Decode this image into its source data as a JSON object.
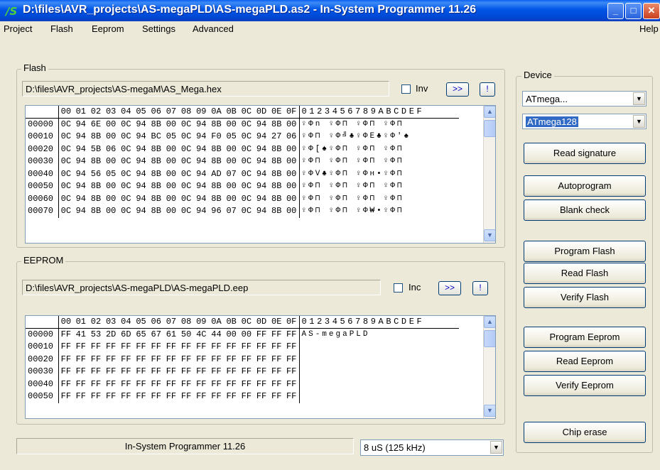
{
  "window": {
    "title": "D:\\files\\AVR_projects\\AS-megaPLD\\AS-megaPLD.as2 - In-System Programmer 11.26",
    "icon": "app-logo-icon"
  },
  "menu": {
    "project": "Project",
    "flash": "Flash",
    "eeprom": "Eeprom",
    "settings": "Settings",
    "advanced": "Advanced",
    "help": "Help"
  },
  "flash": {
    "group_label": "Flash",
    "path": "D:\\files\\AVR_projects\\AS-megaM\\AS_Mega.hex",
    "inv_label": "Inv",
    "inv_checked": false,
    "more_label": ">>",
    "alert_label": "!"
  },
  "eeprom": {
    "group_label": "EEPROM",
    "path": "D:\\files\\AVR_projects\\AS-megaPLD\\AS-megaPLD.eep",
    "inc_label": "Inc",
    "inc_checked": false,
    "more_label": ">>",
    "alert_label": "!"
  },
  "hex_header": {
    "columns": [
      "00",
      "01",
      "02",
      "03",
      "04",
      "05",
      "06",
      "07",
      "08",
      "09",
      "0A",
      "0B",
      "0C",
      "0D",
      "0E",
      "0F"
    ],
    "ascii": "0123456789ABCDEF"
  },
  "flash_rows": [
    {
      "addr": "00000",
      "bytes": [
        "0C",
        "94",
        "6E",
        "00",
        "0C",
        "94",
        "8B",
        "00",
        "0C",
        "94",
        "8B",
        "00",
        "0C",
        "94",
        "8B",
        "00"
      ],
      "ascii": "♀Φn ♀Φ⊓ ♀Φ⊓ ♀Φ⊓"
    },
    {
      "addr": "00010",
      "bytes": [
        "0C",
        "94",
        "8B",
        "00",
        "0C",
        "94",
        "BC",
        "05",
        "0C",
        "94",
        "F0",
        "05",
        "0C",
        "94",
        "27",
        "06"
      ],
      "ascii": "♀Φ⊓ ♀Φ╝♣♀ΦΕ♣♀Φ'♠"
    },
    {
      "addr": "00020",
      "bytes": [
        "0C",
        "94",
        "5B",
        "06",
        "0C",
        "94",
        "8B",
        "00",
        "0C",
        "94",
        "8B",
        "00",
        "0C",
        "94",
        "8B",
        "00"
      ],
      "ascii": "♀Φ[♠♀Φ⊓ ♀Φ⊓ ♀Φ⊓"
    },
    {
      "addr": "00030",
      "bytes": [
        "0C",
        "94",
        "8B",
        "00",
        "0C",
        "94",
        "8B",
        "00",
        "0C",
        "94",
        "8B",
        "00",
        "0C",
        "94",
        "8B",
        "00"
      ],
      "ascii": "♀Φ⊓ ♀Φ⊓ ♀Φ⊓ ♀Φ⊓"
    },
    {
      "addr": "00040",
      "bytes": [
        "0C",
        "94",
        "56",
        "05",
        "0C",
        "94",
        "8B",
        "00",
        "0C",
        "94",
        "AD",
        "07",
        "0C",
        "94",
        "8B",
        "00"
      ],
      "ascii": "♀ΦV♣♀Φ⊓ ♀Φн•♀Φ⊓"
    },
    {
      "addr": "00050",
      "bytes": [
        "0C",
        "94",
        "8B",
        "00",
        "0C",
        "94",
        "8B",
        "00",
        "0C",
        "94",
        "8B",
        "00",
        "0C",
        "94",
        "8B",
        "00"
      ],
      "ascii": "♀Φ⊓ ♀Φ⊓ ♀Φ⊓ ♀Φ⊓"
    },
    {
      "addr": "00060",
      "bytes": [
        "0C",
        "94",
        "8B",
        "00",
        "0C",
        "94",
        "8B",
        "00",
        "0C",
        "94",
        "8B",
        "00",
        "0C",
        "94",
        "8B",
        "00"
      ],
      "ascii": "♀Φ⊓ ♀Φ⊓ ♀Φ⊓ ♀Φ⊓"
    },
    {
      "addr": "00070",
      "bytes": [
        "0C",
        "94",
        "8B",
        "00",
        "0C",
        "94",
        "8B",
        "00",
        "0C",
        "94",
        "96",
        "07",
        "0C",
        "94",
        "8B",
        "00"
      ],
      "ascii": "♀Φ⊓ ♀Φ⊓ ♀Φ₩•♀Φ⊓"
    }
  ],
  "eeprom_rows": [
    {
      "addr": "00000",
      "bytes": [
        "FF",
        "41",
        "53",
        "2D",
        "6D",
        "65",
        "67",
        "61",
        "50",
        "4C",
        "44",
        "00",
        "00",
        "FF",
        "FF",
        "FF"
      ],
      "ascii": " AS-megaPLD"
    },
    {
      "addr": "00010",
      "bytes": [
        "FF",
        "FF",
        "FF",
        "FF",
        "FF",
        "FF",
        "FF",
        "FF",
        "FF",
        "FF",
        "FF",
        "FF",
        "FF",
        "FF",
        "FF",
        "FF"
      ],
      "ascii": ""
    },
    {
      "addr": "00020",
      "bytes": [
        "FF",
        "FF",
        "FF",
        "FF",
        "FF",
        "FF",
        "FF",
        "FF",
        "FF",
        "FF",
        "FF",
        "FF",
        "FF",
        "FF",
        "FF",
        "FF"
      ],
      "ascii": ""
    },
    {
      "addr": "00030",
      "bytes": [
        "FF",
        "FF",
        "FF",
        "FF",
        "FF",
        "FF",
        "FF",
        "FF",
        "FF",
        "FF",
        "FF",
        "FF",
        "FF",
        "FF",
        "FF",
        "FF"
      ],
      "ascii": ""
    },
    {
      "addr": "00040",
      "bytes": [
        "FF",
        "FF",
        "FF",
        "FF",
        "FF",
        "FF",
        "FF",
        "FF",
        "FF",
        "FF",
        "FF",
        "FF",
        "FF",
        "FF",
        "FF",
        "FF"
      ],
      "ascii": ""
    },
    {
      "addr": "00050",
      "bytes": [
        "FF",
        "FF",
        "FF",
        "FF",
        "FF",
        "FF",
        "FF",
        "FF",
        "FF",
        "FF",
        "FF",
        "FF",
        "FF",
        "FF",
        "FF",
        "FF"
      ],
      "ascii": ""
    }
  ],
  "device": {
    "group_label": "Device",
    "family": "ATmega...",
    "model": "ATmega128"
  },
  "buttons": {
    "read_signature": "Read signature",
    "autoprogram": "Autoprogram",
    "blank_check": "Blank check",
    "program_flash": "Program Flash",
    "read_flash": "Read Flash",
    "verify_flash": "Verify Flash",
    "program_eeprom": "Program Eeprom",
    "read_eeprom": "Read Eeprom",
    "verify_eeprom": "Verify Eeprom",
    "chip_erase": "Chip erase"
  },
  "status": {
    "text": "In-System Programmer 11.26",
    "speed": "8 uS (125 kHz)"
  }
}
